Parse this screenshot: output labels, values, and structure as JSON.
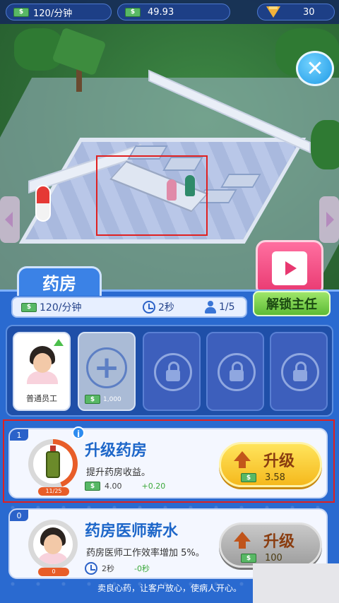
{
  "top_bar": {
    "income_rate": "120/分钟",
    "cash": "49.93",
    "gems": "30"
  },
  "close_label": "✕",
  "room": {
    "tab_title": "药房",
    "unlock_button": "解锁主任",
    "income_rate": "120/分钟",
    "time": "2秒",
    "staff_count": "1/5"
  },
  "staff_slots": {
    "hired_label": "普通员工",
    "add_price": "1,000"
  },
  "upgrades": [
    {
      "level": "1",
      "title": "升级药房",
      "description": "提升药房收益。",
      "current": "4.00",
      "gain": "+0.20",
      "progress_text": "11/25",
      "progress": 0.44,
      "button_label": "升级",
      "price": "3.58",
      "enabled": true
    },
    {
      "level": "0",
      "title": "药房医师薪水",
      "description": "药房医师工作效率增加 5%。",
      "current": "2秒",
      "gain": "-0秒",
      "progress_text": "0",
      "progress": 0,
      "button_label": "升级",
      "price": "100",
      "enabled": false
    }
  ],
  "footer": "卖良心药，让客户放心，使病人开心。",
  "colors": {
    "accent": "#2a6ad0",
    "upgrade": "#f5b91d",
    "unlock": "#5dbb36",
    "video": "#e83870"
  },
  "icons": {
    "cash": "cash-icon",
    "gem": "gem-icon",
    "clock": "clock-icon",
    "staff": "person-icon",
    "lock": "lock-icon",
    "video": "video-icon"
  }
}
